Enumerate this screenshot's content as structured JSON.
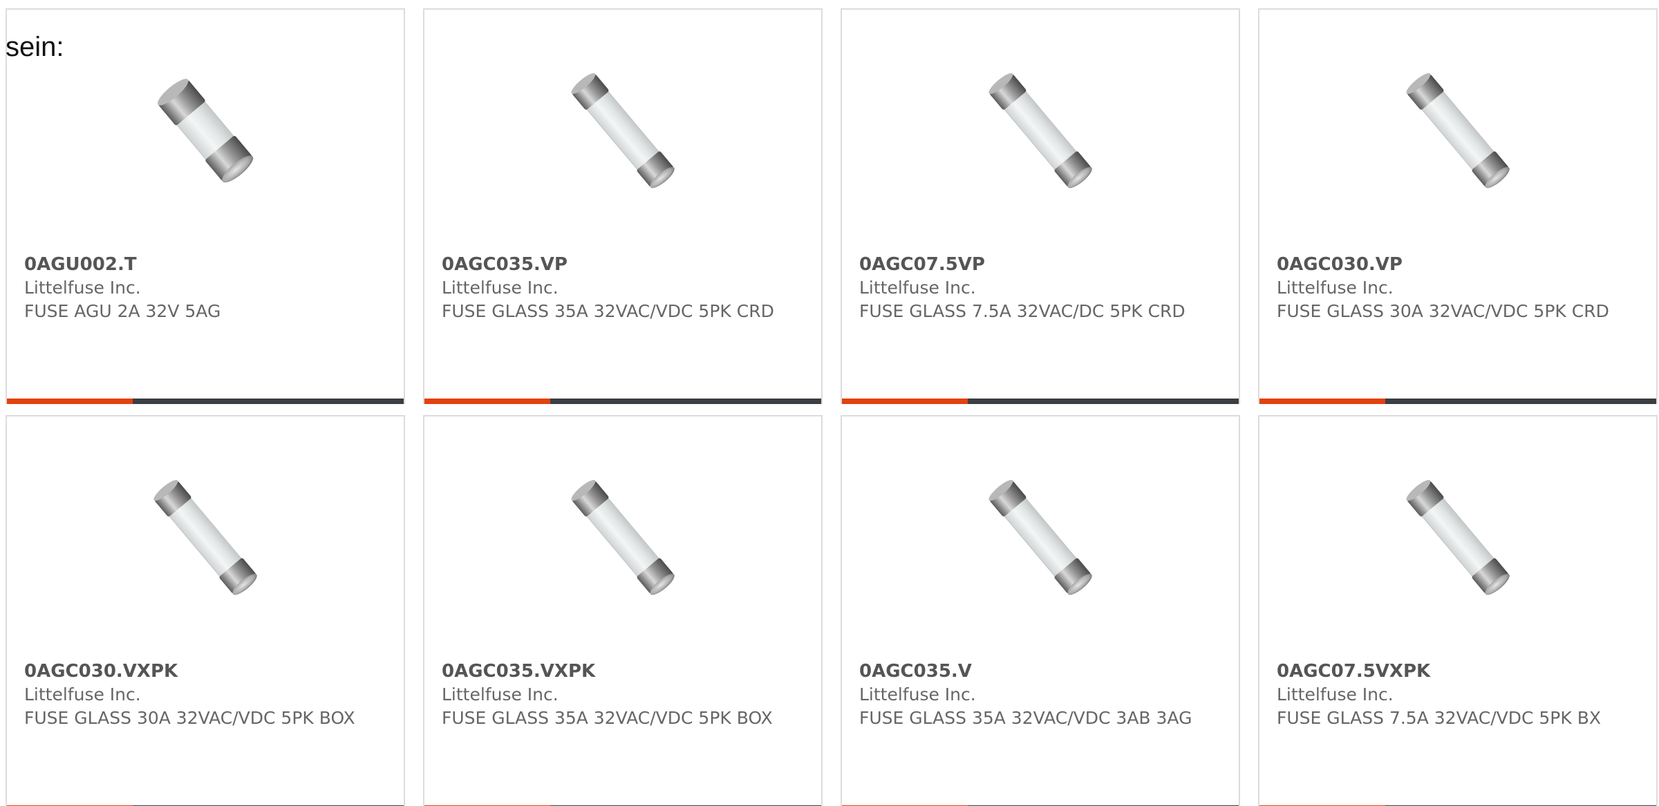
{
  "intro_text": "sein:",
  "colors": {
    "accent": "#e2420f",
    "bar_dark": "#3b3f44",
    "border": "#dcdcdc",
    "text": "#555555"
  },
  "products": [
    {
      "part": "0AGU002.T",
      "maker": "Littelfuse Inc.",
      "desc": "FUSE AGU 2A 32V 5AG",
      "image": "short-fuse-icon"
    },
    {
      "part": "0AGC035.VP",
      "maker": "Littelfuse Inc.",
      "desc": "FUSE GLASS 35A 32VAC/VDC 5PK CRD",
      "image": "glass-fuse-icon"
    },
    {
      "part": "0AGC07.5VP",
      "maker": "Littelfuse Inc.",
      "desc": "FUSE GLASS 7.5A 32VAC/DC 5PK CRD",
      "image": "glass-fuse-icon"
    },
    {
      "part": "0AGC030.VP",
      "maker": "Littelfuse Inc.",
      "desc": "FUSE GLASS 30A 32VAC/VDC 5PK CRD",
      "image": "glass-fuse-icon"
    },
    {
      "part": "0AGC030.VXPK",
      "maker": "Littelfuse Inc.",
      "desc": "FUSE GLASS 30A 32VAC/VDC 5PK BOX",
      "image": "glass-fuse-icon"
    },
    {
      "part": "0AGC035.VXPK",
      "maker": "Littelfuse Inc.",
      "desc": "FUSE GLASS 35A 32VAC/VDC 5PK BOX",
      "image": "glass-fuse-icon"
    },
    {
      "part": "0AGC035.V",
      "maker": "Littelfuse Inc.",
      "desc": "FUSE GLASS 35A 32VAC/VDC 3AB 3AG",
      "image": "glass-fuse-icon"
    },
    {
      "part": "0AGC07.5VXPK",
      "maker": "Littelfuse Inc.",
      "desc": "FUSE GLASS 7.5A 32VAC/VDC 5PK BX",
      "image": "glass-fuse-icon"
    }
  ]
}
